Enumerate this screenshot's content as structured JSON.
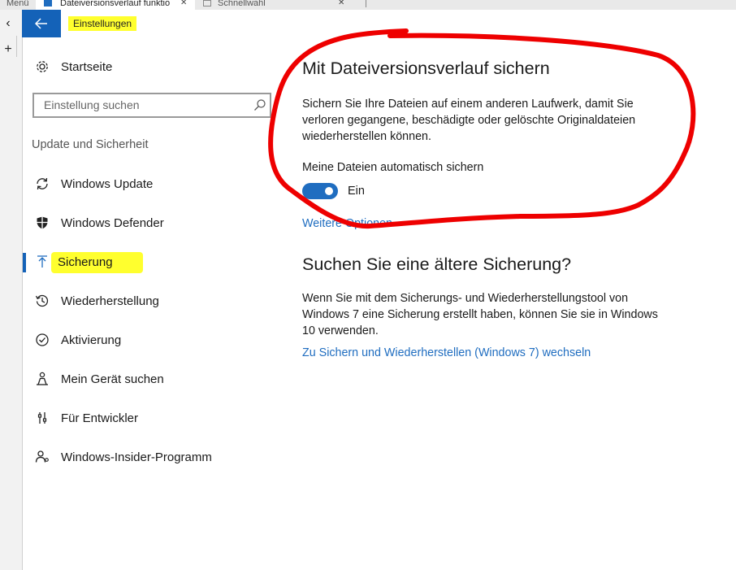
{
  "browser": {
    "tabs": [
      {
        "title": "Menü",
        "active": false
      },
      {
        "title": "Dateiversionsverlauf funktio",
        "active": true
      },
      {
        "title": "Schnellwahl",
        "active": false
      }
    ]
  },
  "window": {
    "title": "Einstellungen"
  },
  "sidebar": {
    "home_label": "Startseite",
    "search": {
      "placeholder": "Einstellung suchen",
      "value": ""
    },
    "section_label": "Update und Sicherheit",
    "items": [
      {
        "label": "Windows Update",
        "icon": "refresh-icon"
      },
      {
        "label": "Windows Defender",
        "icon": "shield-icon"
      },
      {
        "label": "Sicherung",
        "icon": "backup-arrow-icon",
        "selected": true
      },
      {
        "label": "Wiederherstellung",
        "icon": "history-icon"
      },
      {
        "label": "Aktivierung",
        "icon": "check-circle-icon"
      },
      {
        "label": "Mein Gerät suchen",
        "icon": "person-location-icon"
      },
      {
        "label": "Für Entwickler",
        "icon": "developer-tools-icon"
      },
      {
        "label": "Windows-Insider-Programm",
        "icon": "insider-person-icon"
      }
    ]
  },
  "main": {
    "backup": {
      "heading": "Mit Dateiversionsverlauf sichern",
      "description": "Sichern Sie Ihre Dateien auf einem anderen Laufwerk, damit Sie verloren gegangene, beschädigte oder gelöschte Originaldateien wiederherstellen können.",
      "toggle_label": "Meine Dateien automatisch sichern",
      "toggle_state": "Ein",
      "toggle_on": true,
      "more_options_link": "Weitere Optionen"
    },
    "older": {
      "heading": "Suchen Sie eine ältere Sicherung?",
      "description": "Wenn Sie mit dem Sicherungs- und Wiederherstellungstool von Windows 7 eine Sicherung erstellt haben, können Sie sie in Windows 10 verwenden.",
      "link": "Zu Sichern und Wiederherstellen (Windows 7) wechseln"
    }
  },
  "colors": {
    "accent": "#1f6dc0",
    "back_button": "#1462b8",
    "highlight": "#ffff2e",
    "annotation": "#ee0000"
  }
}
